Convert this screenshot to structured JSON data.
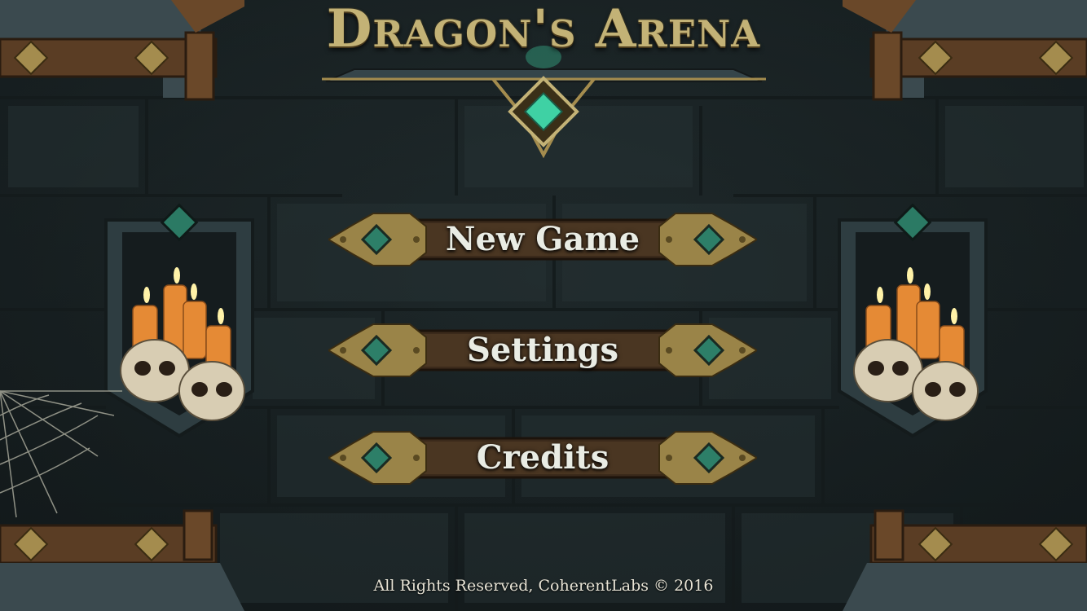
{
  "game": {
    "title": "Dragon's Arena"
  },
  "menu": {
    "items": [
      {
        "id": "new-game",
        "label": "New Game"
      },
      {
        "id": "settings",
        "label": "Settings"
      },
      {
        "id": "credits",
        "label": "Credits"
      }
    ]
  },
  "footer": {
    "copyright": "All Rights Reserved, CoherentLabs © 2016"
  },
  "colors": {
    "background": "#1c2628",
    "gold": "#c3b276",
    "gem": "#3fd1a4",
    "wood": "#5a3d24",
    "candle": "#e58a35",
    "text": "#e9ece4"
  },
  "icons": [
    "emerald-gem-icon",
    "skull-candles-icon",
    "cobweb-icon"
  ]
}
